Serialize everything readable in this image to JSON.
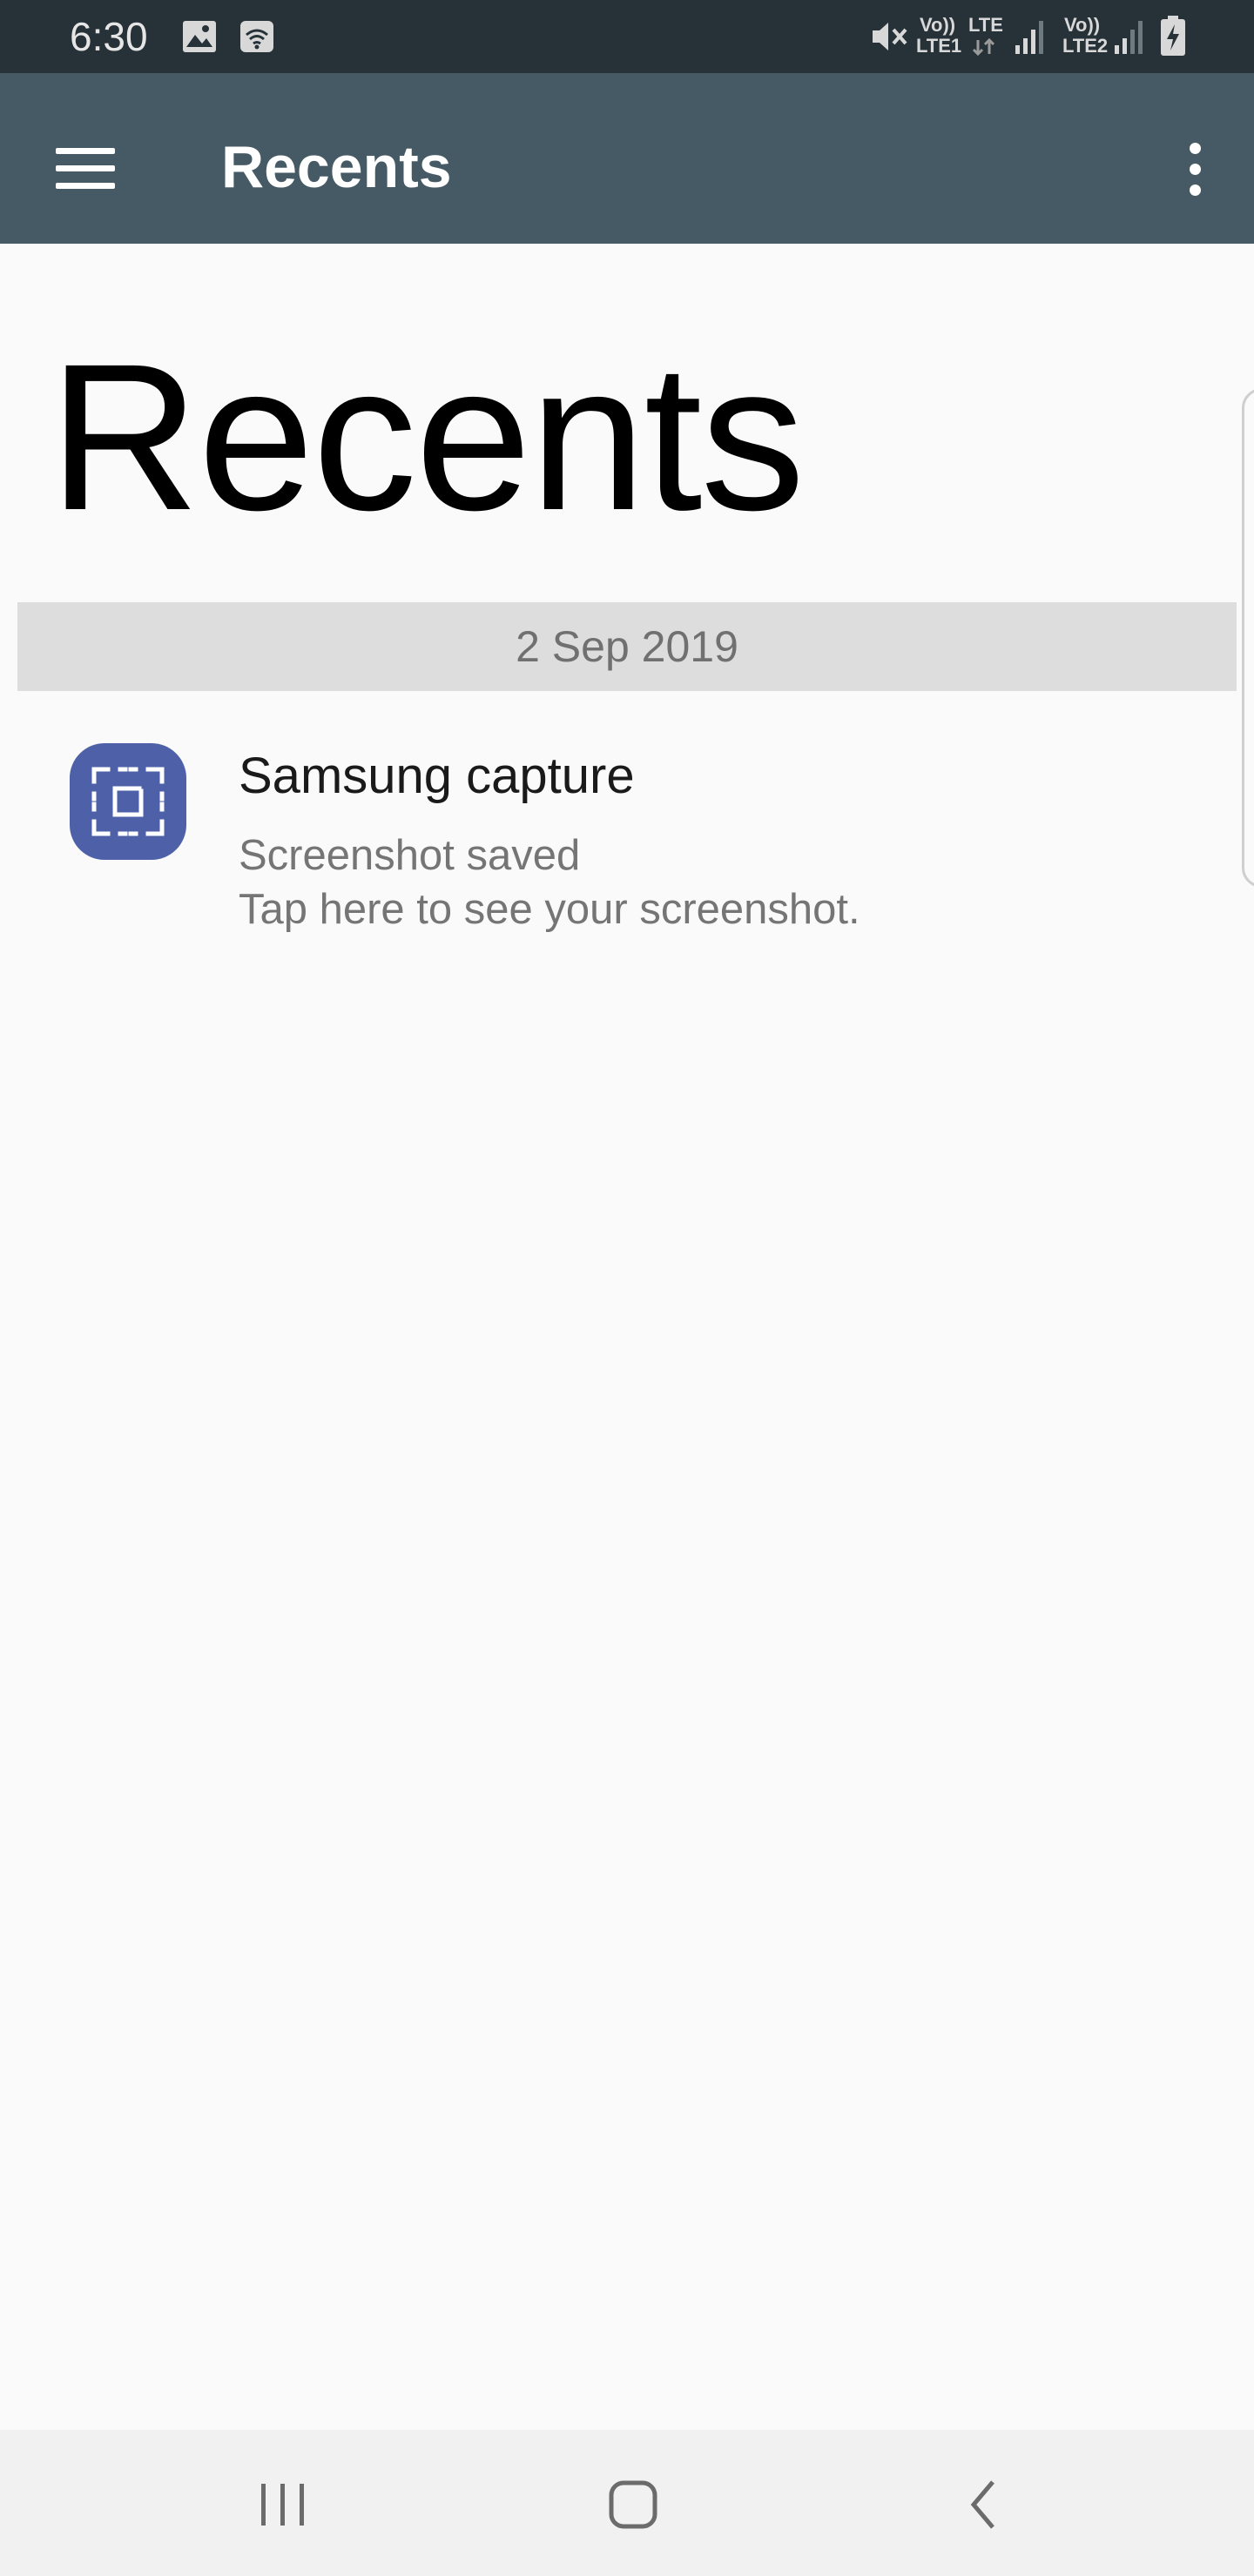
{
  "status_bar": {
    "time": "6:30",
    "sim1_top": "Vo))",
    "sim1_bottom": "LTE1",
    "lte_label": "LTE",
    "sim2_top": "Vo))",
    "sim2_bottom": "LTE2",
    "icons": [
      "image-icon",
      "wifi-icon",
      "mute-icon",
      "signal-icon",
      "signal-icon",
      "battery-charging-icon"
    ]
  },
  "app_bar": {
    "title": "Recents",
    "menu_icon": "menu-icon",
    "more_icon": "more-options-icon",
    "color": "#455a64"
  },
  "page": {
    "heading": "Recents"
  },
  "notifications": {
    "date_header": "2 Sep 2019",
    "items": [
      {
        "app_name": "Samsung capture",
        "text": "Screenshot saved",
        "subtext": "Tap here to see your screenshot.",
        "icon": "samsung-capture-icon",
        "icon_color": "#4e61a8"
      }
    ]
  },
  "nav_bar": {
    "buttons": [
      "recent-apps-icon",
      "home-icon",
      "back-icon"
    ]
  }
}
